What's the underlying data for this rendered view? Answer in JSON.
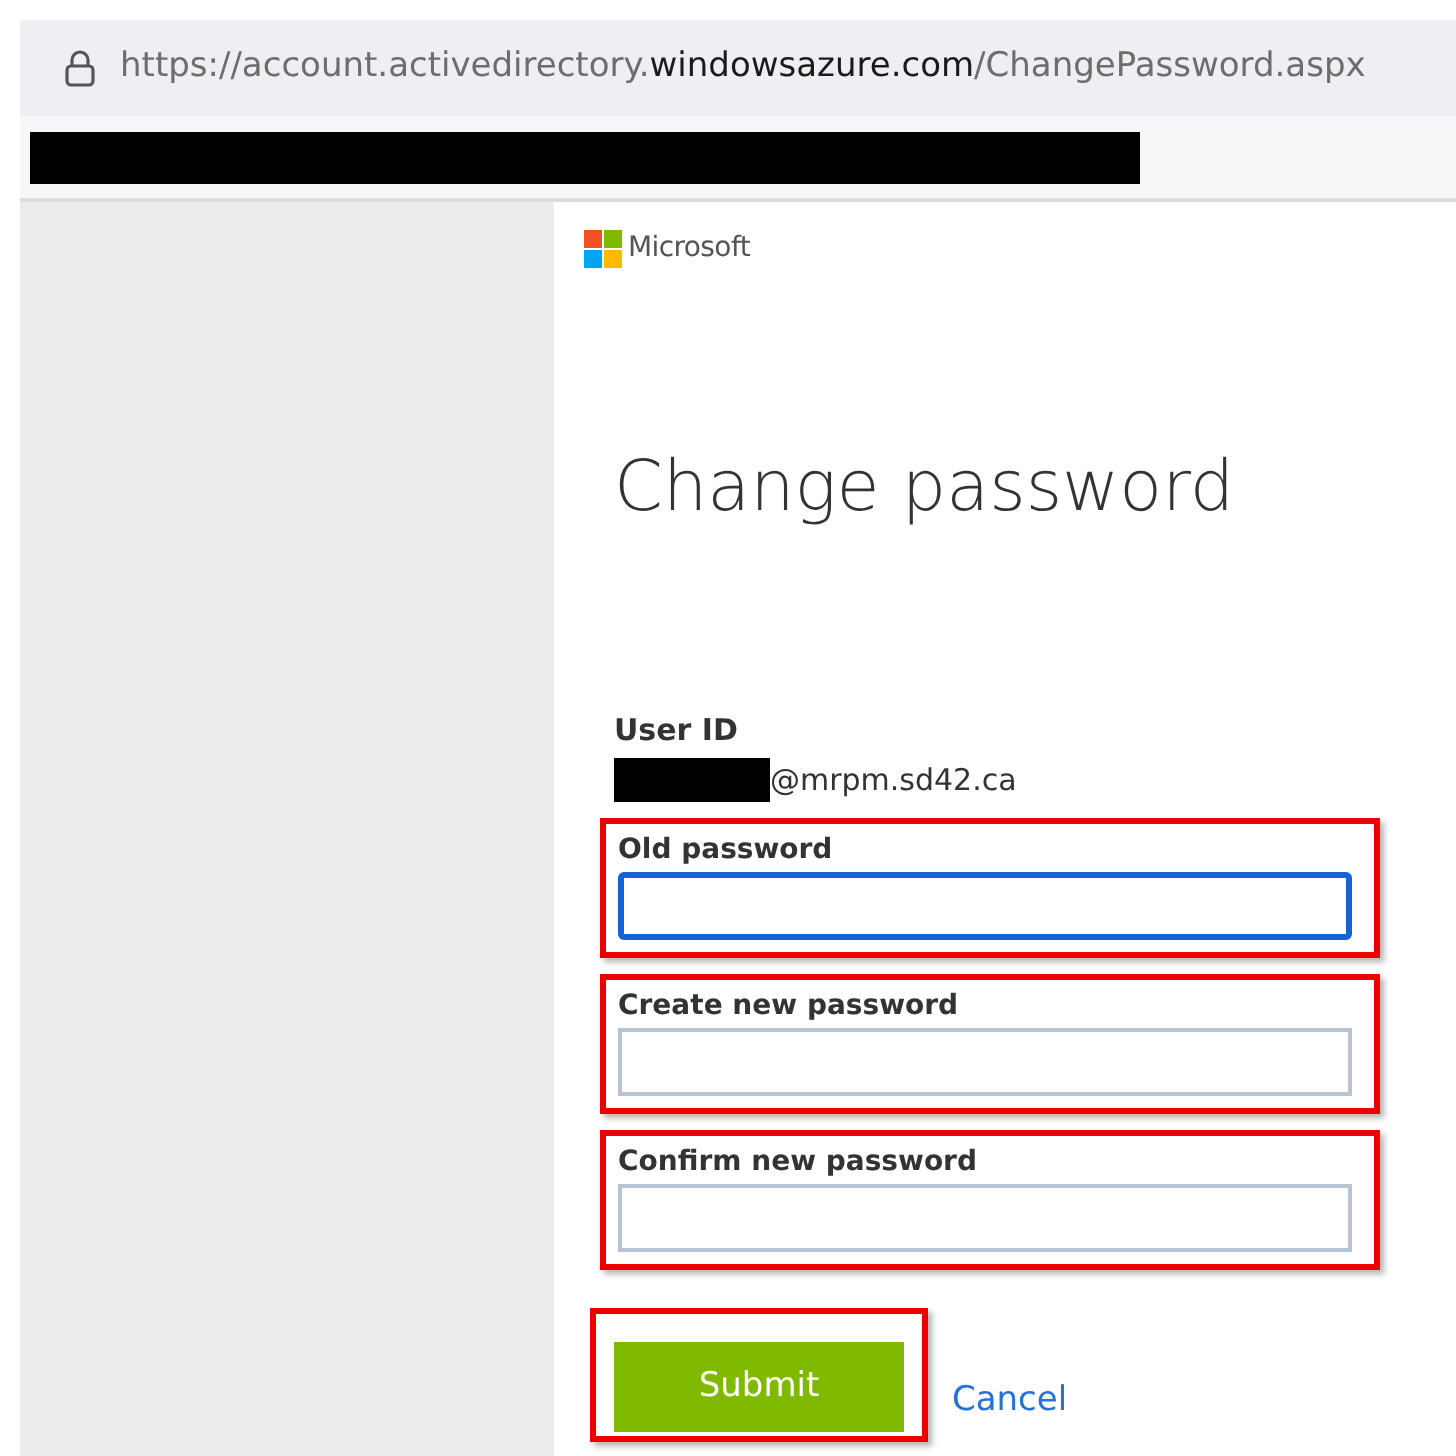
{
  "address_bar": {
    "url_start": "https://account.activedirectory.",
    "url_domain": "windowsazure.com",
    "url_end": "/ChangePassword.aspx"
  },
  "brand": {
    "name": "Microsoft"
  },
  "title": "Change password",
  "user_id": {
    "label": "User ID",
    "value": "@mrpm.sd42.ca"
  },
  "fields": [
    {
      "label": "Old password",
      "focused": true,
      "highlighted": true
    },
    {
      "label": "Create new password",
      "focused": false,
      "highlighted": true
    },
    {
      "label": "Confirm new password",
      "focused": false,
      "highlighted": true
    }
  ],
  "submit": {
    "label": "Submit",
    "highlighted": true
  },
  "cancel": {
    "label": "Cancel"
  }
}
